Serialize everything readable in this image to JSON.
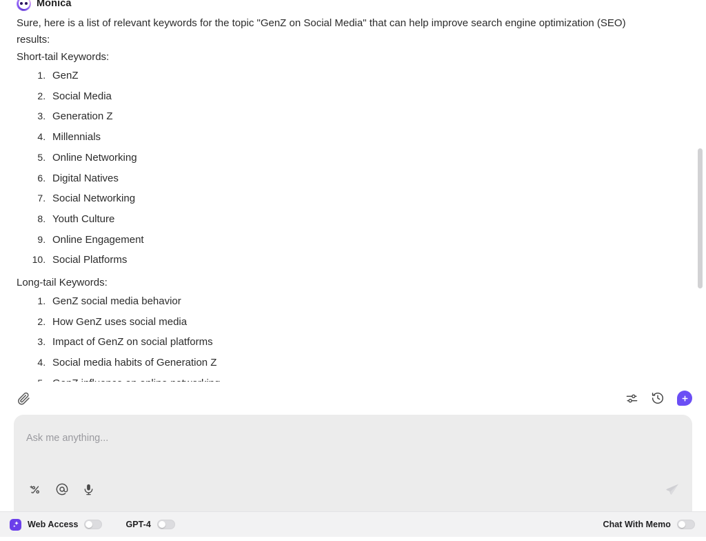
{
  "message": {
    "sender_name": "Monica",
    "avatar_icon": "monica-face-icon",
    "intro_paragraph": "Sure, here is a list of relevant keywords for the topic \"GenZ on Social Media\" that can help improve search engine optimization (SEO) results:",
    "short_tail_heading": "Short-tail Keywords:",
    "short_tail_keywords": [
      "GenZ",
      "Social Media",
      "Generation Z",
      "Millennials",
      "Online Networking",
      "Digital Natives",
      "Social Networking",
      "Youth Culture",
      "Online Engagement",
      "Social Platforms"
    ],
    "long_tail_heading": "Long-tail Keywords:",
    "long_tail_keywords": [
      "GenZ social media behavior",
      "How GenZ uses social media",
      "Impact of GenZ on social platforms",
      "Social media habits of Generation Z",
      "GenZ influence on online networking"
    ]
  },
  "action_bar": {
    "attach_icon": "paperclip-icon",
    "settings_icon": "sliders-icon",
    "history_icon": "history-clock-icon",
    "new_chat_icon": "plus-icon"
  },
  "composer": {
    "placeholder": "Ask me anything...",
    "prompt_icon": "sparkle-wand-icon",
    "mention_icon": "at-mention-icon",
    "voice_icon": "microphone-icon",
    "send_icon": "send-plane-icon"
  },
  "status_bar": {
    "web_access_icon": "web-access-sparkle-icon",
    "web_access_label": "Web Access",
    "web_access_enabled": false,
    "gpt4_label": "GPT-4",
    "gpt4_enabled": false,
    "chat_with_memo_label": "Chat With Memo",
    "chat_with_memo_enabled": false
  },
  "colors": {
    "accent_purple": "#6b4ef5",
    "panel_gray": "#ececec",
    "status_bar_gray": "#f2f2f3",
    "text_primary": "#2b2b2b",
    "placeholder_gray": "#9a9a9f"
  }
}
